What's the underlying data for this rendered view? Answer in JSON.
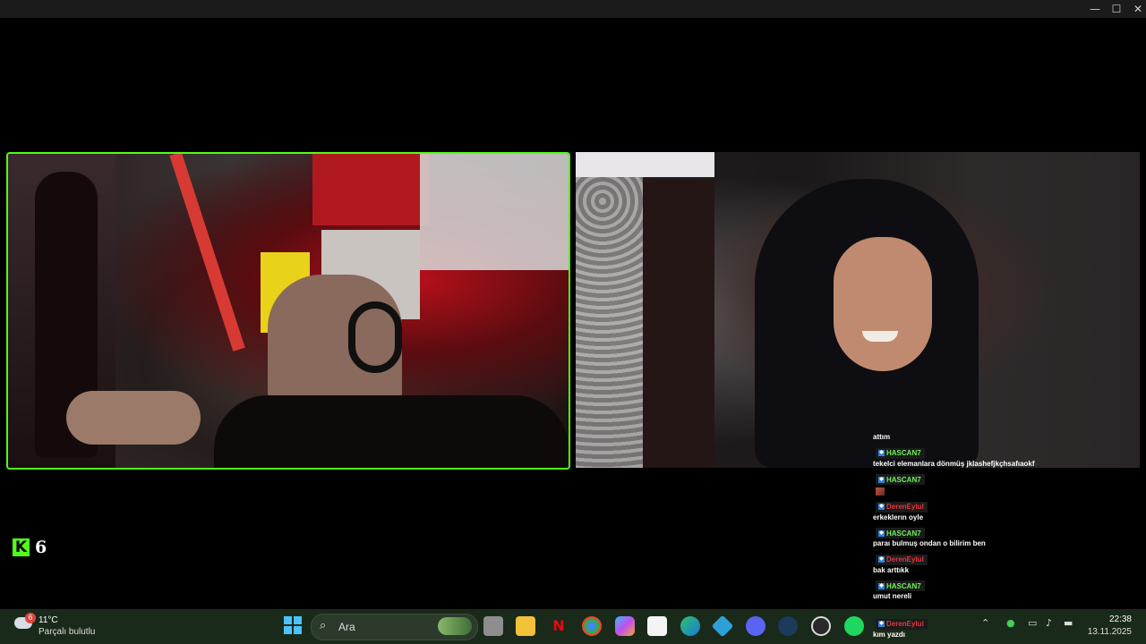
{
  "window": {
    "minimize_icon": "minimize-icon",
    "maximize_icon": "maximize-icon",
    "close_icon": "close-icon",
    "minimize_glyph": "—",
    "maximize_glyph": "☐",
    "close_glyph": "✕"
  },
  "stream": {
    "kick_logo": "K",
    "viewer_count": "6",
    "accent_color": "#53fc18"
  },
  "chat": [
    {
      "user": "",
      "text": "attım"
    },
    {
      "user": "HASCAN7",
      "user_color": "#6ef05a",
      "text": "tekelci elemanlara dönmüş jklashefjkçhsafıaokf"
    },
    {
      "user": "HASCAN7",
      "user_color": "#6ef05a",
      "text": "",
      "emote": true
    },
    {
      "user": "DerenEylul",
      "user_color": "#e0383e",
      "text": "erkeklerın oyle"
    },
    {
      "user": "HASCAN7",
      "user_color": "#6ef05a",
      "text": "paraı bulmuş ondan o bilirim ben"
    },
    {
      "user": "DerenEylul",
      "user_color": "#e0383e",
      "text": "bak arttıkk"
    },
    {
      "user": "HASCAN7",
      "user_color": "#6ef05a",
      "text": "umut nereli"
    },
    {
      "user": "DerenEylul",
      "user_color": "#e0383e",
      "text": "kım yazdı"
    }
  ],
  "taskbar": {
    "weather_temp": "11°C",
    "weather_desc": "Parçalı bulutlu",
    "weather_badge": "6",
    "search_placeholder": "Ara",
    "clock_time": "22:38",
    "clock_date": "13.11.2025",
    "apps": [
      "start",
      "search",
      "task-view",
      "file-explorer",
      "netflix",
      "chrome",
      "copilot",
      "store",
      "edge",
      "app-grid",
      "discord",
      "steam",
      "obs",
      "spotify"
    ]
  }
}
